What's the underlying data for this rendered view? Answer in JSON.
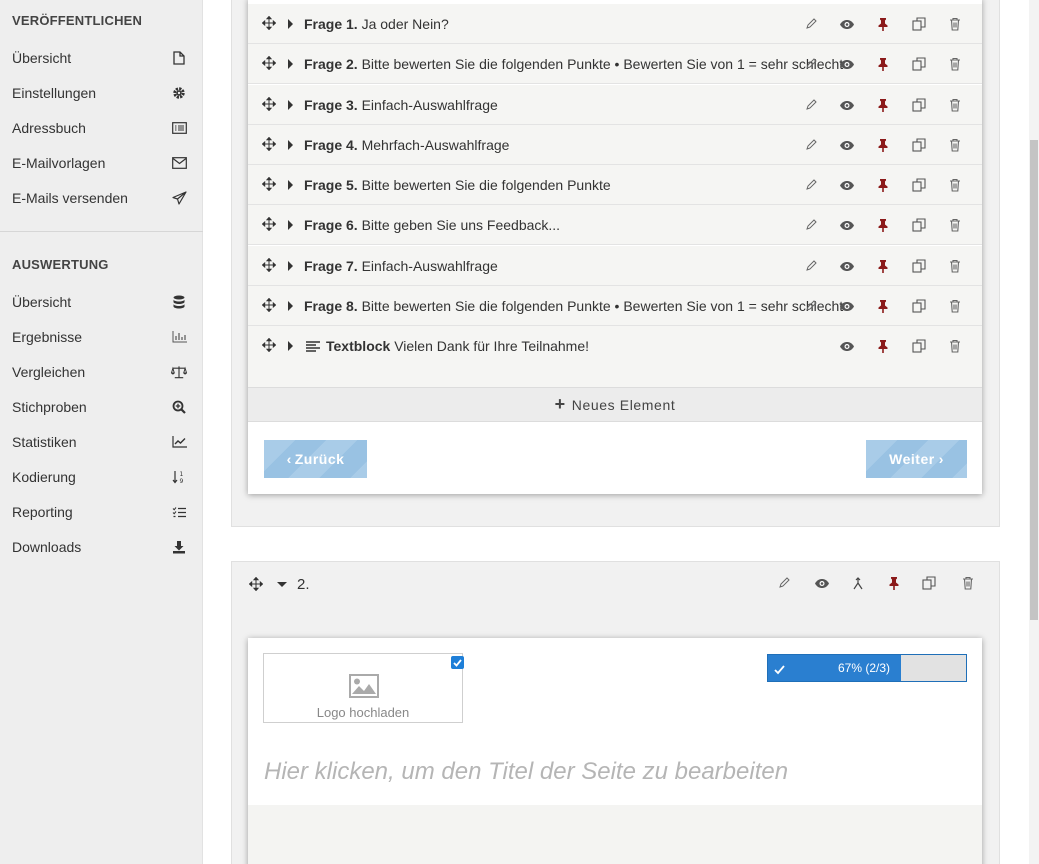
{
  "sidebar": {
    "section1_title": "VERÖFFENTLICHEN",
    "section1_items": [
      {
        "label": "Übersicht",
        "icon": "file-icon"
      },
      {
        "label": "Einstellungen",
        "icon": "gear-icon"
      },
      {
        "label": "Adressbuch",
        "icon": "address-book-icon"
      },
      {
        "label": "E-Mailvorlagen",
        "icon": "envelope-icon"
      },
      {
        "label": "E-Mails versenden",
        "icon": "paper-plane-icon"
      }
    ],
    "section2_title": "AUSWERTUNG",
    "section2_items": [
      {
        "label": "Übersicht",
        "icon": "database-icon"
      },
      {
        "label": "Ergebnisse",
        "icon": "bar-chart-icon"
      },
      {
        "label": "Vergleichen",
        "icon": "balance-scale-icon"
      },
      {
        "label": "Stichproben",
        "icon": "zoom-in-icon"
      },
      {
        "label": "Statistiken",
        "icon": "line-chart-icon"
      },
      {
        "label": "Kodierung",
        "icon": "sort-numeric-icon"
      },
      {
        "label": "Reporting",
        "icon": "checklist-icon"
      },
      {
        "label": "Downloads",
        "icon": "download-icon"
      }
    ]
  },
  "page1": {
    "questions": [
      {
        "label": "Frage 1.",
        "text": "Ja oder Nein?"
      },
      {
        "label": "Frage 2.",
        "text": "Bitte bewerten Sie die folgenden Punkte  •  Bewerten Sie von 1 = sehr schlecht"
      },
      {
        "label": "Frage 3.",
        "text": "Einfach-Auswahlfrage"
      },
      {
        "label": "Frage 4.",
        "text": "Mehrfach-Auswahlfrage"
      },
      {
        "label": "Frage 5.",
        "text": "Bitte bewerten Sie die folgenden Punkte"
      },
      {
        "label": "Frage 6.",
        "text": "Bitte geben Sie uns Feedback..."
      },
      {
        "label": "Frage 7.",
        "text": "Einfach-Auswahlfrage"
      },
      {
        "label": "Frage 8.",
        "text": "Bitte bewerten Sie die folgenden Punkte  •  Bewerten Sie von 1 = sehr schlecht"
      }
    ],
    "textblock": {
      "label": "Textblock",
      "text": "Vielen Dank für Ihre Teilnahme!"
    },
    "new_element": "Neues Element",
    "back_button": "Zurück",
    "next_button": "Weiter"
  },
  "page2": {
    "number": "2.",
    "logo_upload": "Logo hochladen",
    "progress_text": "67% (2/3)",
    "progress_fraction": 0.67,
    "title_placeholder": "Hier klicken, um den Titel der Seite zu bearbeiten"
  },
  "colors": {
    "accent": "#2a7fd0",
    "pin": "#8b1a1a",
    "nav_button": "#a9cce8"
  }
}
